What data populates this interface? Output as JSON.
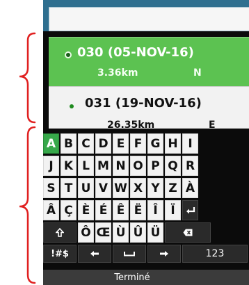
{
  "colors": {
    "annotation": "#e02020",
    "selected_row": "#5cc251",
    "active_key": "#37a84a",
    "topbar": "#2f6f8f"
  },
  "search": {
    "value": ""
  },
  "waypoints": [
    {
      "title": "030 (05-NOV-16)",
      "distance": "3.36km",
      "direction": "N",
      "selected": true
    },
    {
      "title": "031 (19-NOV-16)",
      "distance": "26.35km",
      "direction": "E",
      "selected": false
    }
  ],
  "keyboard": {
    "row1": [
      "A",
      "B",
      "C",
      "D",
      "E",
      "F",
      "G",
      "H",
      "I"
    ],
    "row2": [
      "J",
      "K",
      "L",
      "M",
      "N",
      "O",
      "P",
      "Q",
      "R"
    ],
    "row3": [
      "S",
      "T",
      "U",
      "V",
      "W",
      "X",
      "Y",
      "Z",
      "À"
    ],
    "row4_letters": [
      "Â",
      "Ç",
      "È",
      "É",
      "Ê",
      "Ë",
      "Î",
      "Ï"
    ],
    "row5_letters": [
      "Ô",
      "Œ",
      "Ù",
      "Û",
      "Ü"
    ],
    "symbols_label": "!#$",
    "numbers_label": "123",
    "done_label": "Terminé",
    "icons": [
      "enter-icon",
      "shift-icon",
      "backspace-icon",
      "left-arrow-icon",
      "space-icon",
      "right-arrow-icon"
    ]
  }
}
